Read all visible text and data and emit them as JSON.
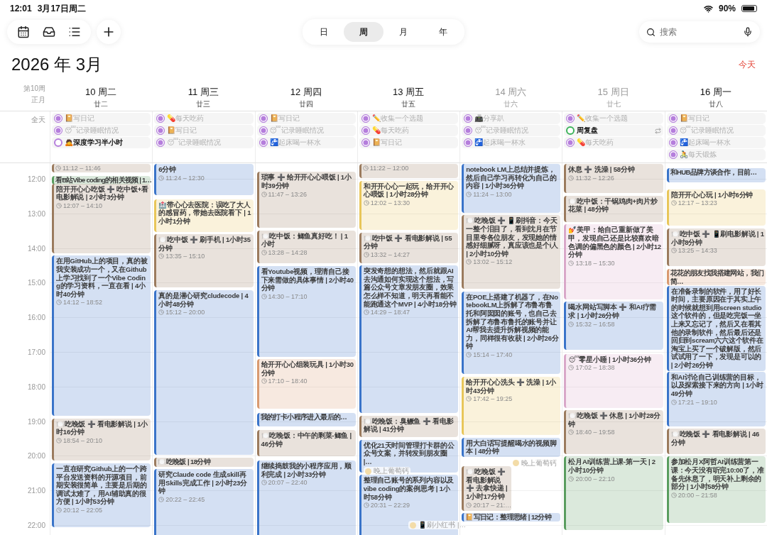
{
  "status_bar": {
    "time": "12:01",
    "date": "3月17日周二",
    "battery": "90%"
  },
  "toolbar": {
    "segments": [
      {
        "label": "日",
        "selected": false
      },
      {
        "label": "周",
        "selected": true
      },
      {
        "label": "月",
        "selected": false
      },
      {
        "label": "年",
        "selected": false
      }
    ],
    "search": {
      "placeholder": "搜索"
    }
  },
  "title": "2026 年 3月",
  "today_button": "今天",
  "week_label": "第10周",
  "lunar_month": "正月",
  "all_day_label": "全天",
  "hours": [
    "12:00",
    "13:00",
    "14:00",
    "15:00",
    "16:00",
    "17:00",
    "18:00",
    "19:00",
    "20:00",
    "21:00",
    "22:00"
  ],
  "days": [
    {
      "date": "10 周二",
      "lunar": "廿二",
      "weekend": false,
      "all_day": [
        {
          "title": "📔写日记",
          "checked": true,
          "color": "#b57edc"
        },
        {
          "title": "😴记录睡眠情况",
          "checked": true,
          "color": "#b57edc"
        },
        {
          "title": "🙇深度学习半小时",
          "checked": false,
          "color": "#b57edc"
        }
      ],
      "events": [
        {
          "kind": "event",
          "time": "11:12 – 11:46",
          "color": "#9b7b5e"
        },
        {
          "kind": "event",
          "title": "看B站Vibe coding的相关视频 | 1…",
          "color": "#5a9d5f"
        },
        {
          "kind": "event",
          "title": "陪开开心心吃饭 ➕ 吃中饭+看电影解说 | 2小时3分钟",
          "time": "12:07 – 14:10",
          "color": "#9b7b5e"
        },
        {
          "kind": "event",
          "title": "在用GitHub上的项目，真的被我安装成功一个，又在Github上学习找到了一个Vibe Coding的学习资料，一直在看 | 4小时40分钟",
          "time": "14:12 – 18:52",
          "color": "#3a74c9"
        },
        {
          "kind": "event",
          "title": "🍽️吃晚饭 ➕ 看电影解说 | 1小时16分钟",
          "time": "18:54 – 20:10",
          "color": "#9b7b5e"
        },
        {
          "kind": "event",
          "title": "一直在研究Github上的一个跨平台发送资料的开源项目，前期安装很简单，主要是后期的调试太难了，用AI辅助真的很方便 | 1小时53分钟",
          "time": "20:12 – 22:05",
          "color": "#3a74c9"
        }
      ]
    },
    {
      "date": "11 周三",
      "lunar": "廿三",
      "weekend": false,
      "all_day": [
        {
          "title": "💊每天吃药",
          "checked": true,
          "color": "#b57edc"
        },
        {
          "title": "📔写日记",
          "checked": true,
          "color": "#b57edc"
        },
        {
          "title": "😴记录睡眠情况",
          "checked": true,
          "color": "#b57edc"
        }
      ],
      "events": [
        {
          "kind": "event",
          "title": "6分钟",
          "time": "11:24 – 12:30",
          "color": "#3a74c9"
        },
        {
          "kind": "event",
          "title": "🏥带心心去医院：误吃了大人的感冒药，带她去医院看下 | 1小时1分钟",
          "color": "#e8c65a"
        },
        {
          "kind": "event",
          "title": "🍽️吃中饭 ➕ 刷手机 | 1小时35分钟",
          "time": "13:35 – 15:10",
          "color": "#9b7b5e"
        },
        {
          "kind": "event",
          "title": "真的是潜心研究cludecode | 4小时48分钟",
          "time": "15:12 – 20:00",
          "color": "#3a74c9"
        },
        {
          "kind": "event",
          "title": "🍽️吃晚饭 | 18分钟",
          "color": "#9b7b5e"
        },
        {
          "kind": "event",
          "title": "研究Claude code 生成skill再用Skills完成工作 | 2小时23分钟",
          "time": "20:22 – 22:45",
          "color": "#3a74c9"
        }
      ]
    },
    {
      "date": "12 周四",
      "lunar": "廿四",
      "weekend": false,
      "all_day": [
        {
          "title": "📔写日记",
          "checked": true,
          "color": "#b57edc"
        },
        {
          "title": "😴记录睡眠情况",
          "checked": true,
          "color": "#b57edc"
        },
        {
          "title": "🚰起床喝一杯水",
          "checked": true,
          "color": "#b57edc"
        }
      ],
      "events": [
        {
          "kind": "event",
          "title": "琐事 ➕ 给开开心心喂饭 | 1小时39分钟",
          "time": "11:47 – 13:26",
          "color": "#9b7b5e"
        },
        {
          "kind": "event",
          "title": "🍽️吃中饭：鲫鱼真好吃！ | 1小时",
          "time": "13:28 – 14:28",
          "color": "#9b7b5e"
        },
        {
          "kind": "event",
          "title": "看Youtube视频，理清自己接下来需做的具体事情 | 2小时40分钟",
          "time": "14:30 – 17:10",
          "color": "#3a74c9"
        },
        {
          "kind": "event",
          "title": "给开开心心组装玩具 | 1小时30分钟",
          "time": "17:10 – 18:40",
          "color": "#d99a70"
        },
        {
          "kind": "event",
          "title": "我的打卡小程序进入最后的…",
          "color": "#3a74c9"
        },
        {
          "kind": "event",
          "title": "🍽️吃晚饭：中午的剩菜-鲫鱼 | 46分钟",
          "color": "#9b7b5e"
        },
        {
          "kind": "event",
          "title": "继续捣鼓我的小程序应用，顺利完成 | 2小时33分钟",
          "time": "20:07 – 22:40",
          "color": "#3a74c9"
        }
      ]
    },
    {
      "date": "13 周五",
      "lunar": "廿五",
      "weekend": false,
      "all_day": [
        {
          "title": "✏️收集一个选题",
          "checked": true,
          "color": "#b57edc"
        },
        {
          "title": "💊每天吃药",
          "checked": true,
          "color": "#b57edc"
        },
        {
          "title": "📔写日记",
          "checked": true,
          "color": "#b57edc"
        }
      ],
      "events": [
        {
          "kind": "event",
          "time": "11:22 – 12:00",
          "color": "#9b7b5e"
        },
        {
          "kind": "event",
          "title": "和开开心心一起玩，给开开心心喂饭 | 1小时28分钟",
          "time": "12:02 – 13:30",
          "color": "#e8c65a"
        },
        {
          "kind": "event",
          "title": "🍽️吃中饭 ➕ 看电影解说 | 55分钟",
          "time": "13:32 – 14:27",
          "color": "#9b7b5e"
        },
        {
          "kind": "event",
          "title": "突发奇想的想法，然后就跟AI去沟通如何实现这个想法，写篇公众号文章发朋友圈，效果怎么样不知道，明天再看能不能跑通这个MVP | 4小时18分钟",
          "time": "14:29 – 18:47",
          "color": "#3a74c9"
        },
        {
          "kind": "event",
          "title": "🍽️吃晚饭：臭鳜鱼 ➕ 看电影解说 | 41分钟",
          "color": "#9b7b5e"
        },
        {
          "kind": "event",
          "title": "优化21天时间管理打卡群的公众号文案，并转发到朋友圈 |…",
          "color": "#3a74c9"
        },
        {
          "kind": "reminder",
          "title": "晚上葡萄钙"
        },
        {
          "kind": "event",
          "title": "整理自己账号的系列内容以及vibe coding的案例思考 | 1小时58分钟",
          "time": "20:31 – 22:29",
          "color": "#3a74c9"
        },
        {
          "kind": "reminder",
          "title": "📱刷小红书 |…"
        }
      ]
    },
    {
      "date": "14 周六",
      "lunar": "廿六",
      "weekend": true,
      "all_day": [
        {
          "title": "📠分享趴",
          "checked": true,
          "color": "#b57edc"
        },
        {
          "title": "😴记录睡眠情况",
          "checked": true,
          "color": "#b57edc"
        },
        {
          "title": "🚰起床喝一杯水",
          "checked": true,
          "color": "#b57edc"
        }
      ],
      "events": [
        {
          "kind": "event",
          "title": "notebook LM上总结并提炼，然后自己学习再转化为自己的内容 | 1小时36分钟",
          "time": "11:24 – 13:00",
          "color": "#3a74c9"
        },
        {
          "kind": "event",
          "title": "🍽️吃晚饭 ➕ 📱刷抖音：今天一整个泪目了，看到沈月在节目里夸各位朋友，发现她的情感好细腻呀，真应该也是个i人 | 2小时10分钟",
          "time": "13:02 – 15:12",
          "color": "#9b7b5e"
        },
        {
          "kind": "event",
          "title": "在POE上搭建了机器了，在NotebookLM上拆解了布鲁布鲁托和阿囡囡的账号，也自己去拆解了布鲁布鲁托的账号并让AI帮我去提升拆解视频的能力，同样很有收获 | 2小时26分钟",
          "time": "15:14 – 17:40",
          "color": "#3a74c9"
        },
        {
          "kind": "event",
          "title": "给开开心心洗头 ➕ 洗澡 | 1小时43分钟",
          "time": "17:42 – 19:25",
          "color": "#e8c65a"
        },
        {
          "kind": "event",
          "title": "用大白话写提醒喝水的视频脚本 | 48分钟",
          "color": "#3a74c9"
        },
        {
          "kind": "reminder",
          "title": "晚上葡萄钙"
        },
        {
          "kind": "event",
          "title": "🍽️吃晚饭 ➕ 看电影解说 ➕ 去拿快递 | 1小时17分钟",
          "time": "20:17 – 21:…",
          "color": "#9b7b5e"
        },
        {
          "kind": "event",
          "title": "📔写日记：整理思绪 | 12分钟",
          "color": "#3a74c9"
        }
      ]
    },
    {
      "date": "15 周日",
      "lunar": "廿七",
      "weekend": true,
      "all_day": [
        {
          "title": "✏️收集一个选题",
          "checked": true,
          "color": "#b57edc"
        },
        {
          "title": "周复盘",
          "checked": false,
          "color": "#3cb35a",
          "repeat": true
        },
        {
          "title": "💊每天吃药",
          "checked": true,
          "color": "#b57edc"
        }
      ],
      "events": [
        {
          "kind": "event",
          "title": "休息 ➕ 洗澡 | 58分钟",
          "time": "11:32 – 12:26",
          "color": "#9b7b5e"
        },
        {
          "kind": "event",
          "title": "🍽️吃中饭：干锅鸡肉+肉片炒花菜 | 48分钟",
          "color": "#9b7b5e"
        },
        {
          "kind": "event",
          "title": "💅美甲：给自己重新做了美甲，发现自己还是比较喜欢暗色调的偏黑色的颜色 | 2小时12分钟",
          "time": "13:18 – 15:30",
          "color": "#d9a8c9"
        },
        {
          "kind": "event",
          "title": "喝水网站写脚本 ➕ 和AI疗需求 | 1小时26分钟",
          "time": "15:32 – 16:58",
          "color": "#3a74c9"
        },
        {
          "kind": "event",
          "title": "😴零星小睡 | 1小时36分钟",
          "time": "17:02 – 18:38",
          "color": "#d9a8c9"
        },
        {
          "kind": "event",
          "title": "🍽️吃晚饭 ➕ 休息 | 1小时28分钟",
          "time": "18:40 – 19:58",
          "color": "#9b7b5e"
        },
        {
          "kind": "event",
          "title": "松月AI训练营上课-第一天 | 2小时10分钟",
          "time": "20:00 – 22:10",
          "color": "#5a9d5f"
        }
      ]
    },
    {
      "date": "16 周一",
      "lunar": "廿八",
      "weekend": false,
      "all_day": [
        {
          "title": "📔写日记",
          "checked": true,
          "color": "#b57edc"
        },
        {
          "title": "😴记录睡眠情况",
          "checked": true,
          "color": "#b57edc"
        },
        {
          "title": "🚰起床喝一杯水",
          "checked": true,
          "color": "#b57edc"
        },
        {
          "title": "🚴每天锻炼",
          "checked": true,
          "color": "#b57edc"
        }
      ],
      "events": [
        {
          "kind": "event",
          "title": "和HUB品牌方谈合作，目前…",
          "color": "#3a74c9"
        },
        {
          "kind": "event",
          "title": "陪开开心心玩 | 1小时6分钟",
          "time": "12:17 – 13:23",
          "color": "#e8c65a"
        },
        {
          "kind": "event",
          "title": "🍽️吃中饭 ➕ 📱刷电影解说 | 1小时8分钟",
          "time": "13:25 – 14:33",
          "color": "#9b7b5e"
        },
        {
          "kind": "event",
          "title": "花花的朋友找我搭建网站，我们简…",
          "color": "#d99a70"
        },
        {
          "kind": "event",
          "title": "在准备录制的软件，用了好长时间，主要原因在于其实上午的时候就想到用screen studio这个软件的，但是吃完饭一坐上来又忘记了，然后又在看其他的录制软件，然后最后还是回归到scream六六这个软件在淘宝上买了一个破解版，然后试试用了一下，发现是可以的 | 2小时26分钟",
          "color": "#3a74c9"
        },
        {
          "kind": "event",
          "title": "和AI讨论自己训练营的目标，以及探索接下来的方向 | 1小时49分钟",
          "time": "17:21 – 19:10",
          "color": "#3a74c9"
        },
        {
          "kind": "event",
          "title": "🍽️吃晚饭 ➕ 看电影解说 | 46分钟",
          "color": "#9b7b5e"
        },
        {
          "kind": "event",
          "title": "参加松月X阿哲AI训练营第一课：今天没有听完10:00了，准备先休息了，明天补上剩余的部分 | 1小时58分钟",
          "time": "20:00 – 21:58",
          "color": "#5a9d5f"
        }
      ]
    }
  ]
}
